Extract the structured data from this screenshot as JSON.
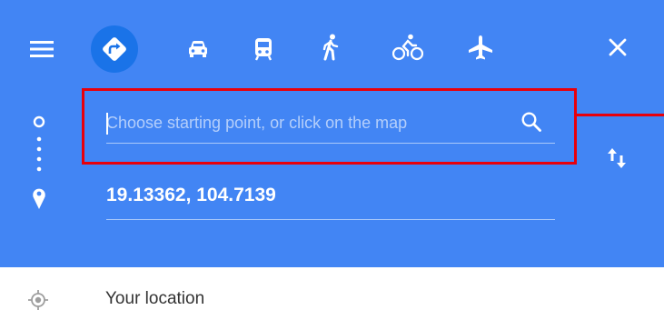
{
  "travel_modes": [
    {
      "name": "Best route",
      "icon": "directions-icon",
      "active": true
    },
    {
      "name": "Driving",
      "icon": "car-icon",
      "active": false
    },
    {
      "name": "Transit",
      "icon": "train-icon",
      "active": false
    },
    {
      "name": "Walking",
      "icon": "walk-icon",
      "active": false
    },
    {
      "name": "Cycling",
      "icon": "bike-icon",
      "active": false
    },
    {
      "name": "Flights",
      "icon": "airplane-icon",
      "active": false
    }
  ],
  "colors": {
    "header_bg": "#4285f4",
    "active_mode_bg": "#1a73e8",
    "highlight": "#e8000b",
    "text_on_blue": "#ffffff",
    "suggestion_text": "#333333",
    "suggestion_icon": "#9e9e9e"
  },
  "directions": {
    "start_placeholder": "Choose starting point, or click on the map",
    "start_value": "",
    "destination_value": "19.13362, 104.7139"
  },
  "suggestions": [
    {
      "label": "Your location",
      "icon": "location-target-icon"
    }
  ]
}
